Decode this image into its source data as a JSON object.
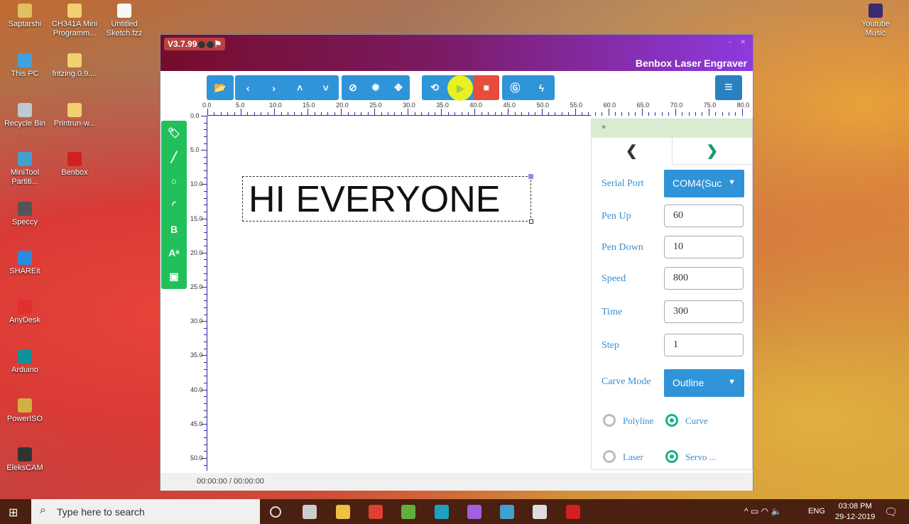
{
  "desktop": {
    "icons": [
      {
        "label": "Saptarshi",
        "color": "#e0c060"
      },
      {
        "label": "CH341A Mini Programm...",
        "color": "#f0d070"
      },
      {
        "label": "Untitled Sketch.fzz",
        "color": "#f8f8f8"
      },
      {
        "label": "This PC",
        "color": "#40a0e0"
      },
      {
        "label": "fritzing.0.9....",
        "color": "#f0d070"
      },
      {
        "label": "Recycle Bin",
        "color": "#c0c8d0"
      },
      {
        "label": "Printrun-w...",
        "color": "#f0d070"
      },
      {
        "label": "MiniTool Partiti...",
        "color": "#40a0d0"
      },
      {
        "label": "Benbox",
        "color": "#d02020"
      },
      {
        "label": "Speccy",
        "color": "#555"
      },
      {
        "label": "SHAREit",
        "color": "#2a8ae0"
      },
      {
        "label": "AnyDesk",
        "color": "#e03030"
      },
      {
        "label": "Arduino",
        "color": "#10909a"
      },
      {
        "label": "PowerISO",
        "color": "#d0b040"
      },
      {
        "label": "EleksCAM",
        "color": "#333"
      },
      {
        "label": "Youtube Music",
        "color": "#3a2a70"
      }
    ]
  },
  "window": {
    "version": "V3.7.99",
    "title": "Benbox Laser Engraver",
    "minimize": "-",
    "close": "×"
  },
  "toolbar": {
    "groups": [
      {
        "icons": [
          "folder-open-icon"
        ],
        "glyphs": [
          "📂"
        ]
      },
      {
        "icons": [
          "arrow-left-icon",
          "arrow-right-icon",
          "arrow-up-icon",
          "arrow-down-icon"
        ],
        "glyphs": [
          "‹",
          "›",
          "˄",
          "˅"
        ]
      },
      {
        "icons": [
          "ban-icon",
          "sun-icon",
          "crosshair-icon"
        ],
        "glyphs": [
          "⊘",
          "✹",
          "✥"
        ]
      },
      {
        "icons": [
          "repeat-icon",
          "play-icon",
          "stop-icon"
        ],
        "glyphs": [
          "⟲",
          "▶",
          "■"
        ]
      },
      {
        "icons": [
          "g-code-icon",
          "lightning-icon"
        ],
        "glyphs": [
          "Ⓖ",
          "ϟ"
        ]
      }
    ],
    "menu_glyph": "≡",
    "accent": "#3094d8",
    "stop_color": "#e84c3d",
    "play_highlight": "#e8f020"
  },
  "ruler": {
    "x_labels": [
      "0.0",
      "5.0",
      "10.0",
      "15.0",
      "20.0",
      "25.0",
      "30.0",
      "35.0",
      "40.0",
      "45.0",
      "50.0",
      "55.0",
      "60.0",
      "65.0",
      "70.0",
      "75.0",
      "80.0"
    ],
    "y_labels": [
      "0.0",
      "5.0",
      "10.0",
      "15.0",
      "20.0",
      "25.0",
      "30.0",
      "35.0",
      "40.0",
      "45.0",
      "50.0"
    ]
  },
  "tools": {
    "icons": [
      "tag-icon",
      "line-icon",
      "circle-icon",
      "arc-icon",
      "bold-text-icon",
      "text-size-icon",
      "image-icon"
    ],
    "glyphs": [
      "🏷",
      "╱",
      "○",
      "◜",
      "B",
      "Aᵃ",
      "▣"
    ],
    "color": "#22c05a"
  },
  "canvas": {
    "text": "HI EVERYONE"
  },
  "panel": {
    "collapse": "»",
    "tab_prev": "❮",
    "tab_next": "❯",
    "serial_port": {
      "label": "Serial Port",
      "value": "COM4(Suc"
    },
    "fields": [
      {
        "label": "Pen Up",
        "value": "60"
      },
      {
        "label": "Pen Down",
        "value": "10"
      },
      {
        "label": "Speed",
        "value": "800"
      },
      {
        "label": "Time",
        "value": "300"
      },
      {
        "label": "Step",
        "value": "1"
      }
    ],
    "carve_mode": {
      "label": "Carve Mode",
      "value": "Outline"
    },
    "radios": [
      {
        "label": "Polyline",
        "checked": false
      },
      {
        "label": "Curve",
        "checked": true
      },
      {
        "label": "Laser",
        "checked": false
      },
      {
        "label": "Servo ...",
        "checked": true
      }
    ]
  },
  "status": {
    "time": "00:00:00 / 00:00:00"
  },
  "taskbar": {
    "search_placeholder": "Type here to search",
    "lang": "ENG",
    "time": "03:08 PM",
    "date": "29-12-2019",
    "apps": [
      {
        "name": "cortana",
        "color": "#ddd"
      },
      {
        "name": "task-view",
        "color": "#ccc"
      },
      {
        "name": "file-explorer",
        "color": "#f0c040"
      },
      {
        "name": "chrome",
        "color": "#e04030"
      },
      {
        "name": "utorrent",
        "color": "#60b040"
      },
      {
        "name": "filmora",
        "color": "#20a0c0"
      },
      {
        "name": "feather",
        "color": "#a060e0"
      },
      {
        "name": "recorder",
        "color": "#40a0d0"
      },
      {
        "name": "app",
        "color": "#ddd"
      },
      {
        "name": "benbox",
        "color": "#d02020"
      }
    ]
  }
}
